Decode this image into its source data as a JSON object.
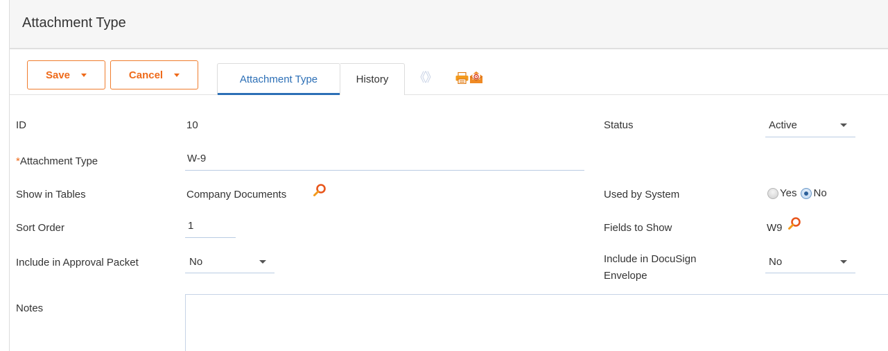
{
  "page": {
    "title": "Attachment Type"
  },
  "toolbar": {
    "save_label": "Save",
    "cancel_label": "Cancel",
    "nav_arrows": "《》",
    "accent_color": "#ee6a1a"
  },
  "tabs": [
    {
      "label": "Attachment Type",
      "active": true
    },
    {
      "label": "History",
      "active": false
    }
  ],
  "icons": {
    "print": "print-icon",
    "email": "email-icon",
    "lookup": "search-icon"
  },
  "form": {
    "id": {
      "label": "ID",
      "value": "10"
    },
    "attachment_type": {
      "required_marker": "*",
      "label": "Attachment Type",
      "value": "W-9"
    },
    "show_in_tables": {
      "label": "Show in Tables",
      "value": "Company Documents"
    },
    "sort_order": {
      "label": "Sort Order",
      "value": "1"
    },
    "include_in_approval_packet": {
      "label": "Include in Approval Packet",
      "value": "No"
    },
    "notes": {
      "label": "Notes",
      "value": ""
    },
    "status": {
      "label": "Status",
      "value": "Active"
    },
    "used_by_system": {
      "label": "Used by System",
      "options": [
        "Yes",
        "No"
      ],
      "selected": "No"
    },
    "fields_to_show": {
      "label": "Fields to Show",
      "value": "W9"
    },
    "include_in_docusign": {
      "label_line1": "Include in DocuSign",
      "label_line2": "Envelope",
      "value": "No"
    }
  }
}
